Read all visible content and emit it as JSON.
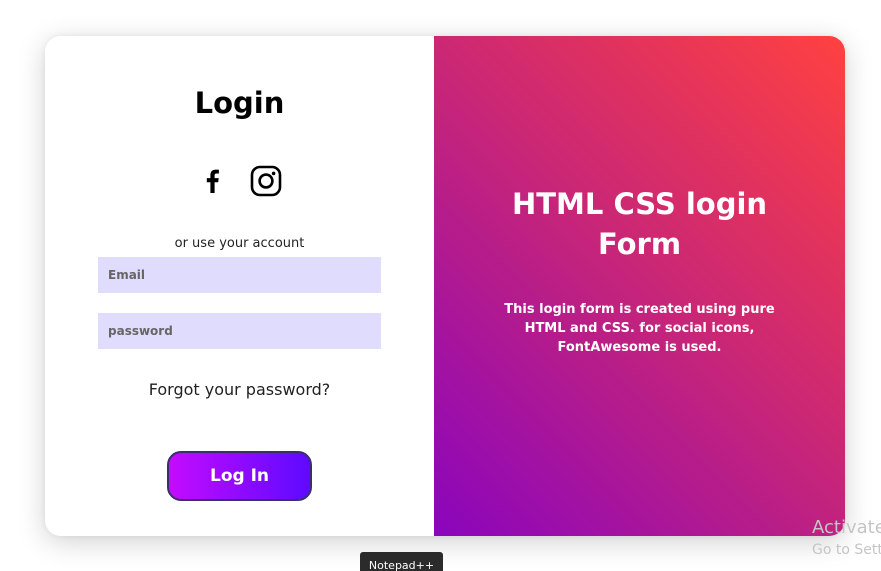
{
  "login_panel": {
    "title": "Login",
    "social": [
      {
        "name": "facebook-icon"
      },
      {
        "name": "instagram-icon"
      }
    ],
    "alt_text": "or use your account",
    "email": {
      "placeholder": "Email",
      "value": ""
    },
    "password": {
      "placeholder": "password",
      "value": ""
    },
    "forgot_link": "Forgot your password?",
    "login_button": "Log In"
  },
  "info_panel": {
    "heading": "HTML CSS login Form",
    "description": "This login form is created using pure HTML and CSS. for social icons, FontAwesome is used."
  },
  "os_overlay": {
    "activate_title": "Activate",
    "activate_subtitle": "Go to Setti",
    "taskbar_tooltip": "Notepad++"
  },
  "colors": {
    "gradient_start": "#8a05bd",
    "gradient_mid": "#c0227f",
    "gradient_end": "#ff4140",
    "input_background": "#e0dcfd",
    "button_start": "#c40bff",
    "button_end": "#5d0aff"
  }
}
